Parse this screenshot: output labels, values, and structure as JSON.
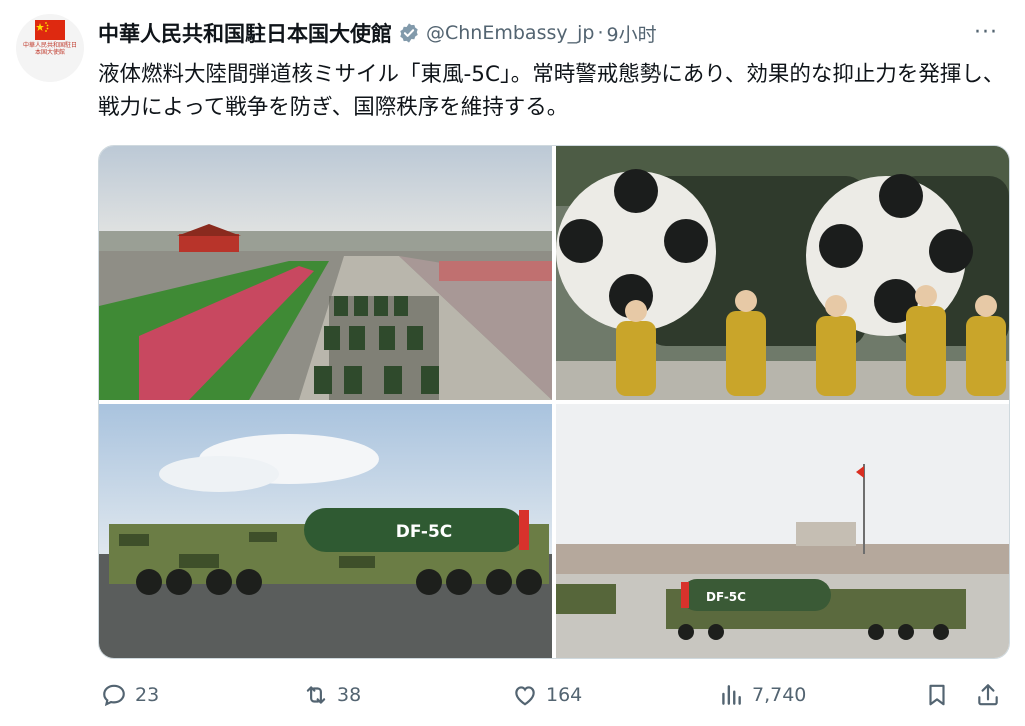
{
  "author": {
    "name": "中華人民共和国駐日本国大使館",
    "handle": "@ChnEmbassy_jp",
    "separator": "·",
    "time": "9小时",
    "avatar_text": "中華人民共和国駐日本国大使館",
    "verified_badge": "verified-icon",
    "badge_color": "#829aab"
  },
  "tweet": {
    "text": "液体燃料大陸間弾道核ミサイル「東風-5C」。常時警戒態勢にあり、効果的な抑止力を発揮し、戦力によって戦争を防ぎ、国際秩序を維持する。"
  },
  "media": {
    "count": 4,
    "missile_label": "DF-5C"
  },
  "actions": {
    "reply_count": "23",
    "retweet_count": "38",
    "like_count": "164",
    "view_count": "7,740",
    "more_label": "···"
  },
  "colors": {
    "text": "#0f1419",
    "muted": "#536471",
    "flag_red": "#de2910",
    "flag_yellow": "#ffde00"
  }
}
